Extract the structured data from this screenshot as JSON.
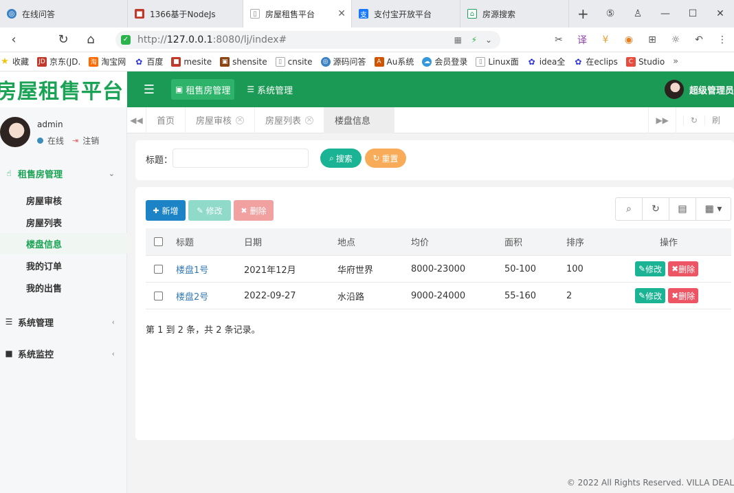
{
  "browser": {
    "tabs": [
      {
        "title": "在线问答",
        "color": "#3b82c4"
      },
      {
        "title": "1366基于NodeJs",
        "color": "#c0392b"
      },
      {
        "title": "房屋租售平台",
        "color": "#888888"
      },
      {
        "title": "支付宝开放平台",
        "color": "#1677ff"
      },
      {
        "title": "房源搜索",
        "color": "#1aa354"
      }
    ],
    "url_prefix": "http://",
    "url_host": "127.0.0.1",
    "url_rest": ":8080/lj/index#",
    "bookmarks": [
      "收藏",
      "京东(JD.",
      "淘宝网",
      "百度",
      "mesite",
      "shensite",
      "cnsite",
      "源码问答",
      "Au系统",
      "会员登录",
      "Linux面",
      "idea全",
      "在eclips",
      "Studio"
    ]
  },
  "app": {
    "logo": "房屋租售平台",
    "nav": [
      "租售房管理",
      "系统管理"
    ],
    "user_top": "超级管理员"
  },
  "sidebar": {
    "username": "admin",
    "status": "在线",
    "logout": "注销",
    "group_rent": "租售房管理",
    "items": [
      "房屋审核",
      "房屋列表",
      "楼盘信息",
      "我的订单",
      "我的出售"
    ],
    "group_system": "系统管理",
    "group_monitor": "系统监控"
  },
  "content_tabs": {
    "tabs": [
      "首页",
      "房屋审核",
      "房屋列表",
      "楼盘信息"
    ],
    "refresh": "刷"
  },
  "search": {
    "label": "标题：",
    "value": "",
    "search_btn": "搜索",
    "reset_btn": "重置"
  },
  "toolbar": {
    "add": "新增",
    "edit": "修改",
    "delete": "删除"
  },
  "table": {
    "headers": [
      "标题",
      "日期",
      "地点",
      "均价",
      "面积",
      "排序",
      "操作"
    ],
    "rows": [
      {
        "title": "楼盘1号",
        "date": "2021年12月",
        "place": "华府世界",
        "price": "8000-23000",
        "area": "50-100",
        "order": "100"
      },
      {
        "title": "楼盘2号",
        "date": "2022-09-27",
        "place": "水沿路",
        "price": "9000-24000",
        "area": "55-160",
        "order": "2"
      }
    ],
    "op_edit": "修改",
    "op_delete": "删除",
    "summary": "第 1 到 2 条，共 2 条记录。"
  },
  "footer": "© 2022 All Rights Reserved. VILLA DEAL"
}
